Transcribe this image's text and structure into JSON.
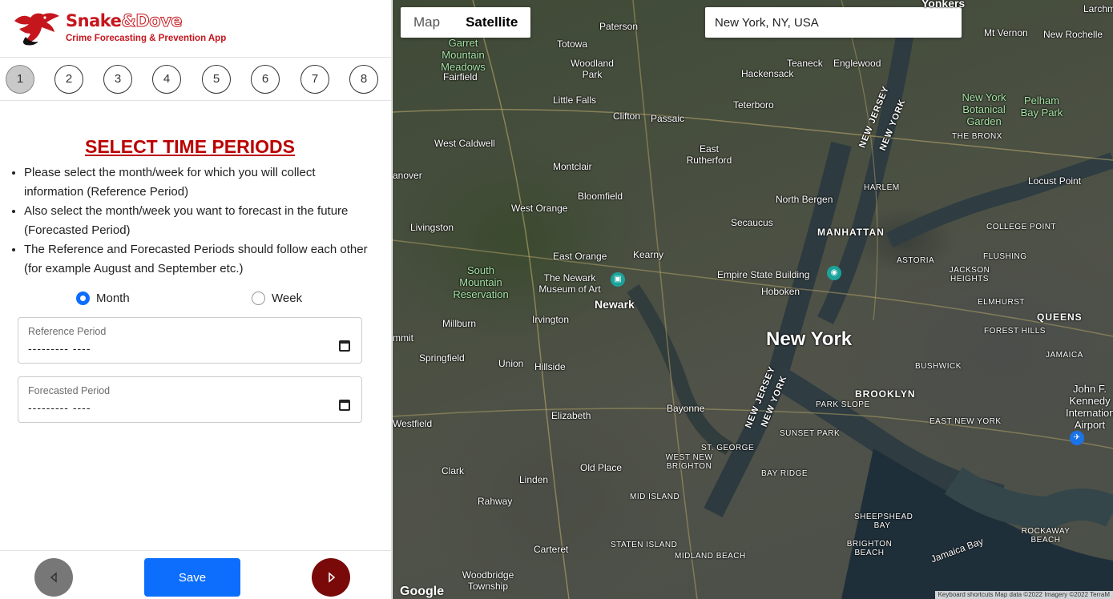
{
  "app": {
    "brand_main": "Snake",
    "brand_amp": "&",
    "brand_dove": "Dove",
    "tagline": "Crime Forecasting & Prevention App"
  },
  "steps": [
    "1",
    "2",
    "3",
    "4",
    "5",
    "6",
    "7",
    "8"
  ],
  "active_step": "1",
  "page": {
    "title": "SELECT TIME PERIODS",
    "instructions": [
      "Please select the month/week for which you will collect information (Reference Period)",
      "Also select the month/week you want to forecast in the future (Forecasted Period)",
      "The Reference and Forecasted Periods should follow each other (for example August and September etc.)"
    ],
    "radio_month": "Month",
    "radio_week": "Week",
    "selected_period_type": "Month",
    "reference_label": "Reference Period",
    "reference_value": "--------- ----",
    "forecast_label": "Forecasted Period",
    "forecast_value": "--------- ----"
  },
  "footer": {
    "save_label": "Save",
    "prev_icon": "chevron-left-icon",
    "next_icon": "chevron-right-icon"
  },
  "map": {
    "tab_map": "Map",
    "tab_satellite": "Satellite",
    "active_tab": "Satellite",
    "search_value": "New York, NY, USA",
    "google": "Google",
    "attribution": "Keyboard shortcuts  Map data ©2022 Imagery ©2022 TerraM",
    "labels": {
      "new_york": "New York",
      "newark": "Newark",
      "manhattan": "MANHATTAN",
      "brooklyn": "BROOKLYN",
      "queens": "QUEENS",
      "hoboken": "Hoboken",
      "bayonne": "Bayonne",
      "elizabeth": "Elizabeth",
      "jfk": "John F. Kennedy International Airport",
      "empire": "Empire State Building",
      "newark_museum": "The Newark Museum of Art",
      "south_mountain": "South Mountain Reservation",
      "garret": "Garret Mountain Meadows",
      "ny_botanical": "New York Botanical Garden",
      "pelham": "Pelham Bay Park",
      "the_bronx": "THE BRONX",
      "harlem": "HARLEM",
      "astoria": "ASTORIA",
      "jackson_heights": "JACKSON HEIGHTS",
      "flushing": "FLUSHING",
      "elmhurst": "ELMHURST",
      "forest_hills": "FOREST HILLS",
      "jamaica": "JAMAICA",
      "bushwick": "BUSHWICK",
      "park_slope": "PARK SLOPE",
      "sunset_park": "SUNSET PARK",
      "bay_ridge": "BAY RIDGE",
      "east_new_york": "EAST NEW YORK",
      "sheepshead": "SHEEPSHEAD BAY",
      "brighton": "BRIGHTON BEACH",
      "rockaway": "ROCKAWAY BEACH",
      "jamaica_bay": "Jamaica Bay",
      "st_george": "ST. GEORGE",
      "west_brighton": "WEST NEW BRIGHTON",
      "mid_island": "MID ISLAND",
      "staten_island": "STATEN ISLAND",
      "midland_beach": "MIDLAND BEACH",
      "college_point": "COLLEGE POINT",
      "yonkers": "Yonkers",
      "mt_vernon": "Mt Vernon",
      "new_rochelle": "New Rochelle",
      "locust_point": "Locust Point",
      "paterson": "Paterson",
      "totowa": "Totowa",
      "woodland_park": "Woodland Park",
      "fairfield": "Fairfield",
      "little_falls": "Little Falls",
      "clifton": "Clifton",
      "passaic": "Passaic",
      "west_caldwell": "West Caldwell",
      "montclair": "Montclair",
      "bloomfield": "Bloomfield",
      "east_rutherford": "East Rutherford",
      "teaneck": "Teaneck",
      "englewood": "Englewood",
      "hackensack": "Hackensack",
      "teterboro": "Teterboro",
      "north_bergen": "North Bergen",
      "secaucus": "Secaucus",
      "kearny": "Kearny",
      "east_orange": "East Orange",
      "west_orange": "West Orange",
      "livingston": "Livingston",
      "millburn": "Millburn",
      "irvington": "Irvington",
      "springfield": "Springfield",
      "union": "Union",
      "hillside": "Hillside",
      "westfield": "Westfield",
      "clark": "Clark",
      "linden": "Linden",
      "rahway": "Rahway",
      "old_place": "Old Place",
      "carteret": "Carteret",
      "woodbridge": "Woodbridge Township",
      "new_jersey": "NEW JERSEY",
      "new_york_state": "NEW YORK",
      "hanover": "anover",
      "summit": "mmit",
      "lachmont": "Larchmont"
    }
  }
}
